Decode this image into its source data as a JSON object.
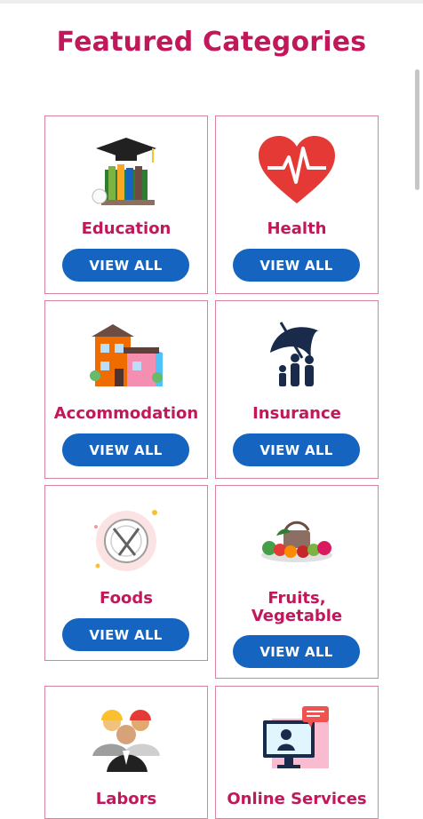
{
  "page_title": "Featured Categories",
  "button_label": "VIEW ALL",
  "colors": {
    "accent": "#c2185b",
    "button": "#1565c0",
    "border": "#d4849f"
  },
  "categories": [
    {
      "label": "Education",
      "icon": "graduation-books-icon"
    },
    {
      "label": "Health",
      "icon": "heart-pulse-icon"
    },
    {
      "label": "Accommodation",
      "icon": "house-icon"
    },
    {
      "label": "Insurance",
      "icon": "umbrella-family-icon"
    },
    {
      "label": "Foods",
      "icon": "plate-cutlery-icon"
    },
    {
      "label": "Fruits,\nVegetable",
      "label_line1": "Fruits,",
      "label_line2": "Vegetable",
      "icon": "fruit-basket-icon"
    },
    {
      "label": "Labors",
      "icon": "workers-icon"
    },
    {
      "label": "Online Services",
      "icon": "online-services-icon"
    }
  ]
}
